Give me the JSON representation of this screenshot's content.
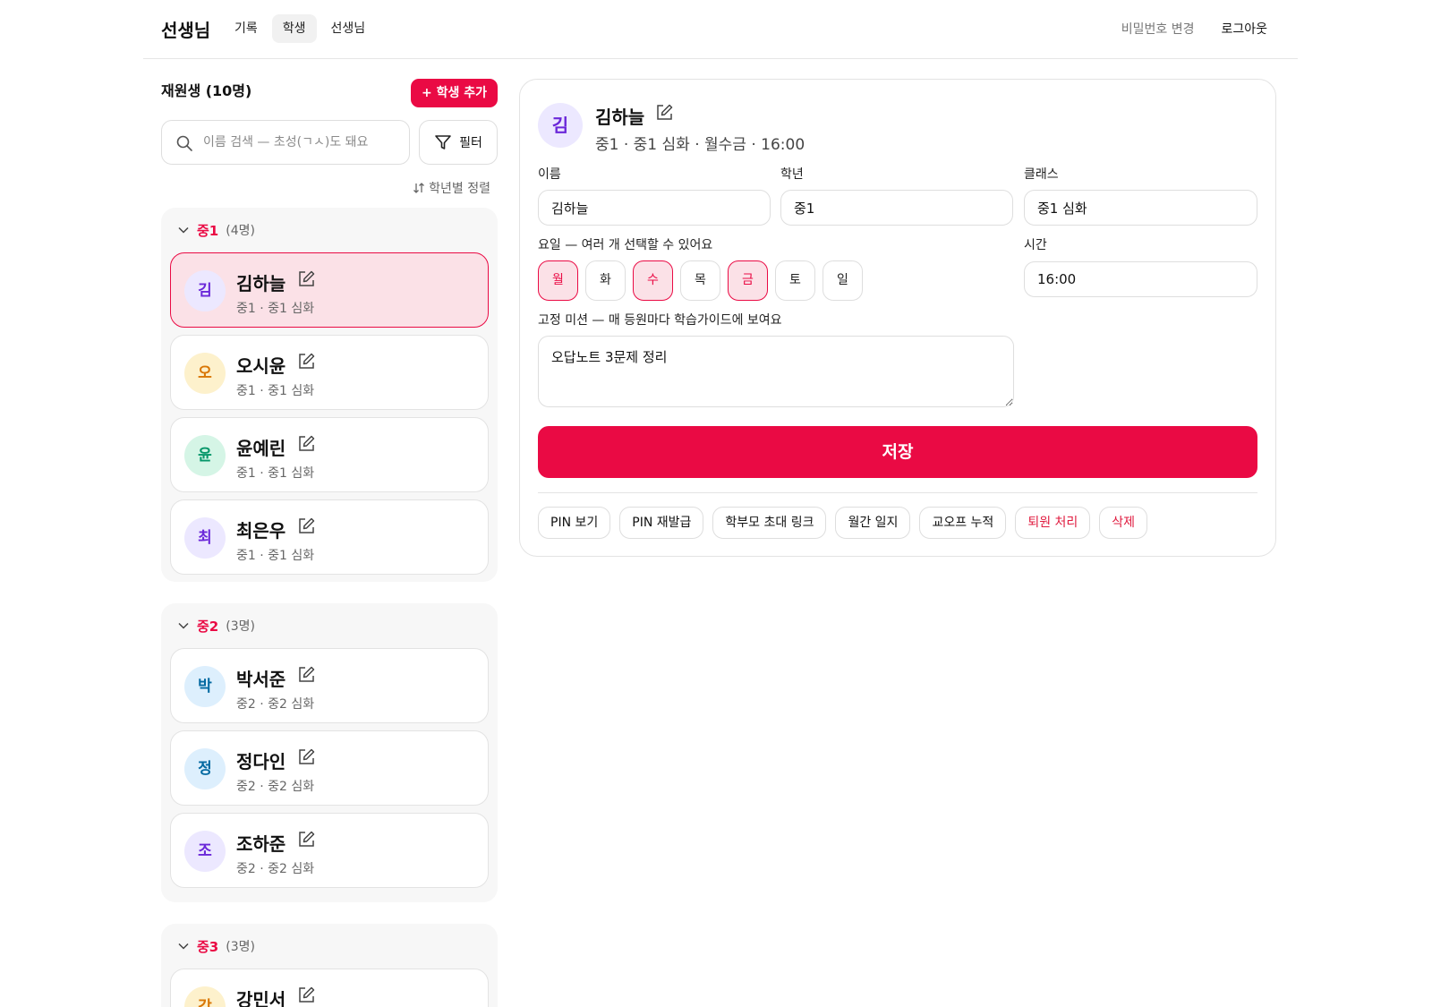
{
  "header": {
    "brand": "선생님",
    "nav": [
      {
        "label": "기록",
        "active": false
      },
      {
        "label": "학생",
        "active": true
      },
      {
        "label": "선생님",
        "active": false
      }
    ],
    "change_password": "비밀번호 변경",
    "logout": "로그아웃"
  },
  "sidebar": {
    "title": "재원생 (10명)",
    "add_button": "+ 학생 추가",
    "search_placeholder": "이름 검색 — 초성(ㄱㅅ)도 돼요",
    "filter_label": "필터",
    "sort_label": "학년별 정렬",
    "groups": [
      {
        "name": "중1",
        "count": "(4명)",
        "students": [
          {
            "initial": "김",
            "name": "김하늘",
            "sub": "중1 · 중1 심화",
            "selected": true
          },
          {
            "initial": "오",
            "name": "오시윤",
            "sub": "중1 · 중1 심화",
            "selected": false
          },
          {
            "initial": "윤",
            "name": "윤예린",
            "sub": "중1 · 중1 심화",
            "selected": false
          },
          {
            "initial": "최",
            "name": "최은우",
            "sub": "중1 · 중1 심화",
            "selected": false
          }
        ]
      },
      {
        "name": "중2",
        "count": "(3명)",
        "students": [
          {
            "initial": "박",
            "name": "박서준",
            "sub": "중2 · 중2 심화",
            "selected": false
          },
          {
            "initial": "정",
            "name": "정다인",
            "sub": "중2 · 중2 심화",
            "selected": false
          },
          {
            "initial": "조",
            "name": "조하준",
            "sub": "중2 · 중2 심화",
            "selected": false
          }
        ]
      },
      {
        "name": "중3",
        "count": "(3명)",
        "students": [
          {
            "initial": "강",
            "name": "강민서",
            "sub": "",
            "selected": false
          }
        ]
      }
    ]
  },
  "detail": {
    "initial": "김",
    "name": "김하늘",
    "subtitle": "중1 · 중1 심화 · 월수금 · 16:00",
    "labels": {
      "name": "이름",
      "grade": "학년",
      "class": "클래스",
      "days": "요일 — 여러 개 선택할 수 있어요",
      "time": "시간",
      "mission": "고정 미션 — 매 등원마다 학습가이드에 보여요"
    },
    "values": {
      "name": "김하늘",
      "grade": "중1",
      "class": "중1 심화",
      "time": "16:00",
      "mission": "오답노트 3문제 정리"
    },
    "days": [
      {
        "label": "월",
        "on": true
      },
      {
        "label": "화",
        "on": false
      },
      {
        "label": "수",
        "on": true
      },
      {
        "label": "목",
        "on": false
      },
      {
        "label": "금",
        "on": true
      },
      {
        "label": "토",
        "on": false
      },
      {
        "label": "일",
        "on": false
      }
    ],
    "save": "저장",
    "actions": [
      {
        "label": "PIN 보기",
        "danger": false
      },
      {
        "label": "PIN 재발급",
        "danger": false
      },
      {
        "label": "학부모 초대 링크",
        "danger": false
      },
      {
        "label": "월간 일지",
        "danger": false
      },
      {
        "label": "교오프 누적",
        "danger": false
      },
      {
        "label": "퇴원 처리",
        "danger": true
      },
      {
        "label": "삭제",
        "danger": true
      }
    ]
  },
  "colors": {
    "accent": "#ea0a44",
    "selected_bg": "#fbe1e7",
    "avatar_purple": "#6b28d9",
    "avatar_orange": "#d97706",
    "avatar_green": "#059669",
    "avatar_blue": "#0369a1"
  }
}
